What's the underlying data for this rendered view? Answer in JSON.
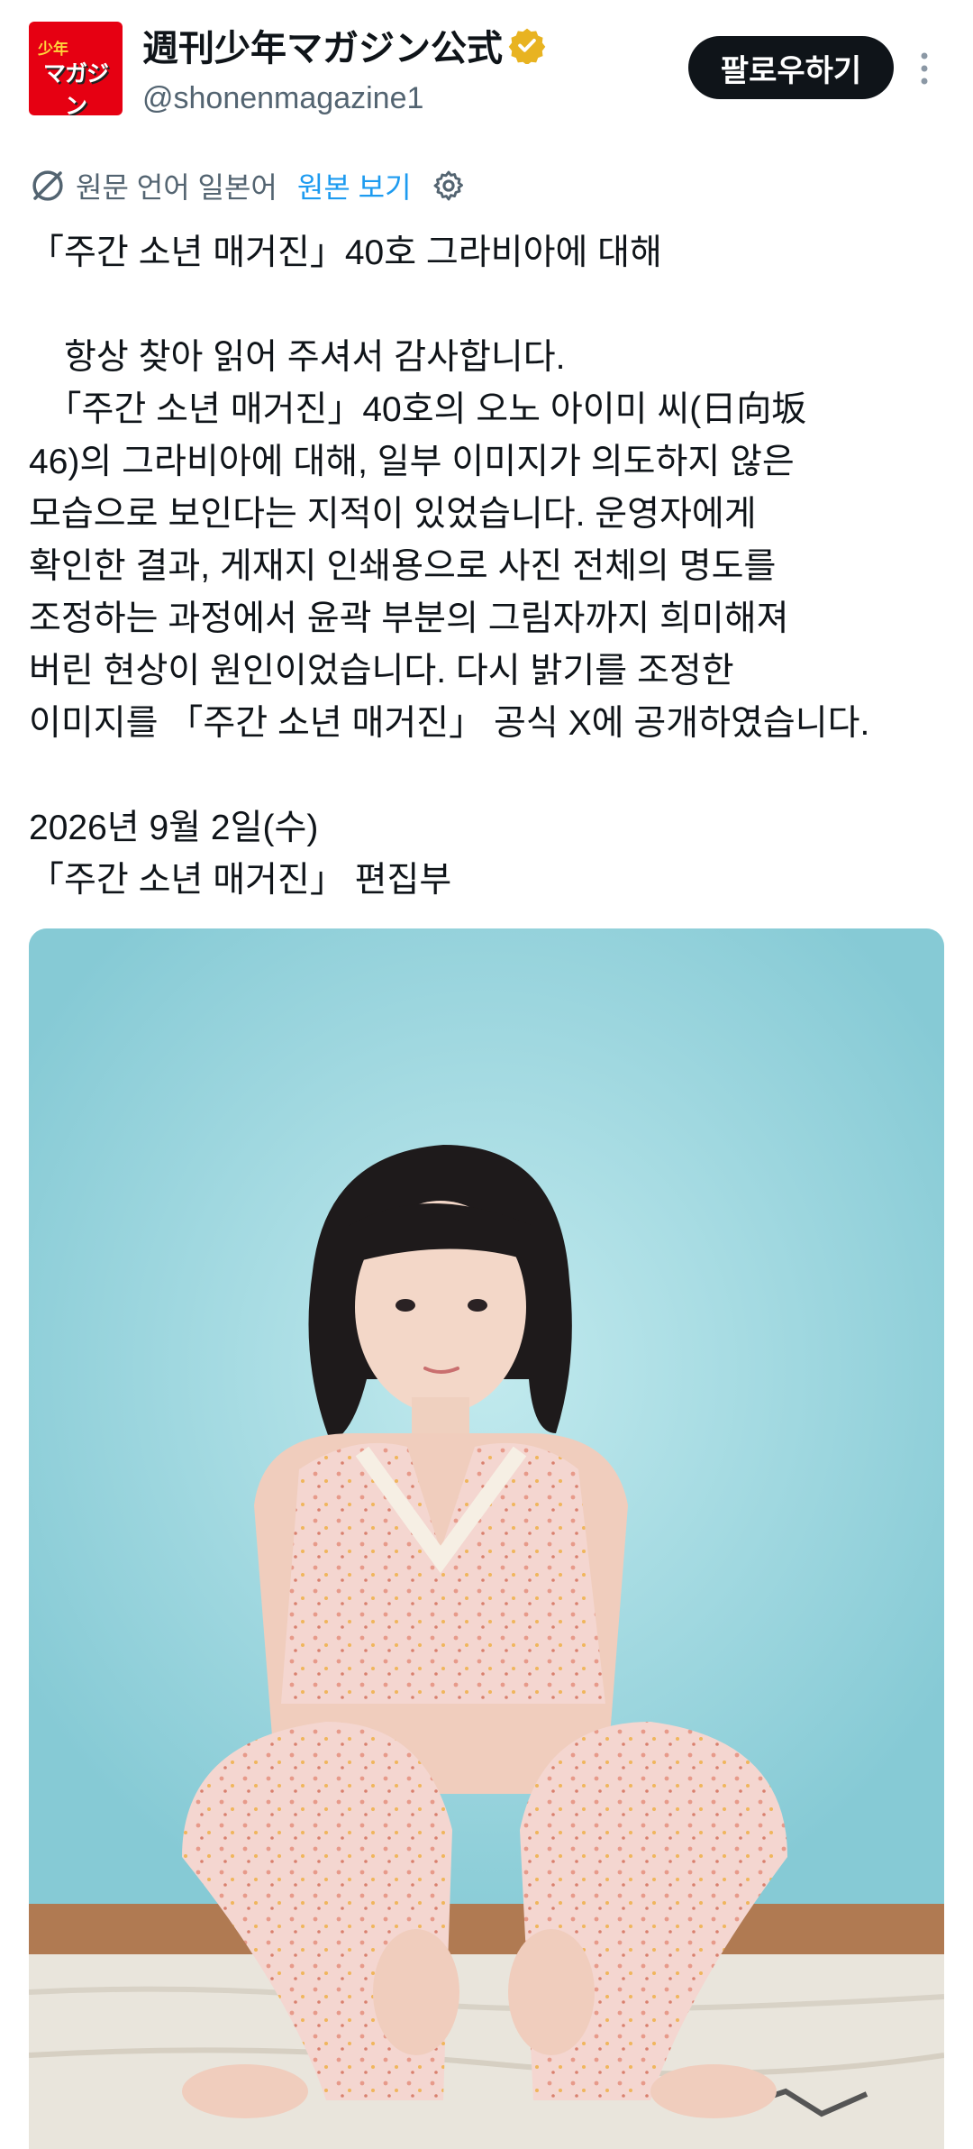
{
  "header": {
    "avatar_logo_small": "少年",
    "avatar_logo_big": "マガジン",
    "display_name": "週刊少年マガジン公式",
    "handle": "@shonenmagazine1",
    "follow_label": "팔로우하기",
    "verified_icon": "verified-badge-icon",
    "more_icon": "more-vertical-icon"
  },
  "translation": {
    "language_note": "원문 언어 일본어",
    "show_original": "원본 보기"
  },
  "tweet": {
    "lines": [
      "「주간 소년 매거진」40호 그라비아에 대해",
      "",
      "　항상 찾아 읽어 주셔서 감사합니다.",
      "　「주간 소년 매거진」40호의 오노 아이미 씨(日向坂",
      "46)의 그라비아에 대해, 일부 이미지가 의도하지 않은",
      "모습으로 보인다는 지적이 있었습니다. 운영자에게",
      "확인한 결과, 게재지 인쇄용으로 사진 전체의 명도를",
      "조정하는 과정에서 윤곽 부분의 그림자까지 희미해져",
      "버린 현상이 원인이었습니다. 다시 밝기를 조정한",
      "이미지를 「주간 소년 매거진」 공식 X에 공개하였습니다.",
      "",
      "2026년 9월 2일(수)",
      "「주간 소년 매거진」 편집부"
    ]
  },
  "colors": {
    "brand": "#e60012",
    "link": "#1d9bf0",
    "muted": "#536471",
    "verified": "#e8b321"
  }
}
